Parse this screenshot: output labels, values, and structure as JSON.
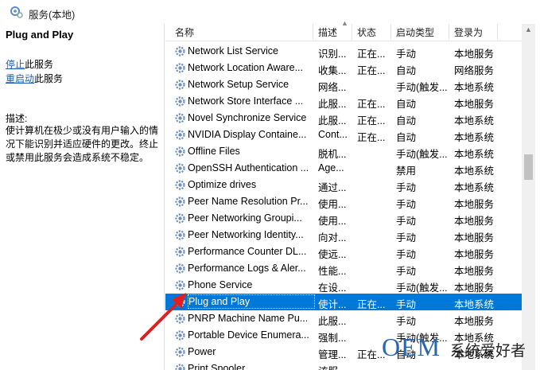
{
  "window": {
    "title": "服务(本地)"
  },
  "left_panel": {
    "service_name": "Plug and Play",
    "stop_link": "停止",
    "stop_suffix": "此服务",
    "restart_link": "重启动",
    "restart_suffix": "此服务",
    "desc_label": "描述:",
    "desc_text": "使计算机在极少或没有用户输入的情况下能识别并适应硬件的更改。终止或禁用此服务会造成系统不稳定。"
  },
  "table": {
    "headers": {
      "name": "名称",
      "desc": "描述",
      "status": "状态",
      "startup": "启动类型",
      "logon": "登录为"
    },
    "rows": [
      {
        "name": "Network List Service",
        "desc": "识别...",
        "status": "正在...",
        "startup": "手动",
        "logon": "本地服务"
      },
      {
        "name": "Network Location Aware...",
        "desc": "收集...",
        "status": "正在...",
        "startup": "自动",
        "logon": "网络服务"
      },
      {
        "name": "Network Setup Service",
        "desc": "网络...",
        "status": "",
        "startup": "手动(触发...",
        "logon": "本地系统"
      },
      {
        "name": "Network Store Interface ...",
        "desc": "此服...",
        "status": "正在...",
        "startup": "自动",
        "logon": "本地服务"
      },
      {
        "name": "Novel Synchronize Service",
        "desc": "此服...",
        "status": "正在...",
        "startup": "自动",
        "logon": "本地系统"
      },
      {
        "name": "NVIDIA Display Containe...",
        "desc": "Cont...",
        "status": "正在...",
        "startup": "自动",
        "logon": "本地系统"
      },
      {
        "name": "Offline Files",
        "desc": "脱机...",
        "status": "",
        "startup": "手动(触发...",
        "logon": "本地系统"
      },
      {
        "name": "OpenSSH Authentication ...",
        "desc": "Age...",
        "status": "",
        "startup": "禁用",
        "logon": "本地系统"
      },
      {
        "name": "Optimize drives",
        "desc": "通过...",
        "status": "",
        "startup": "手动",
        "logon": "本地系统"
      },
      {
        "name": "Peer Name Resolution Pr...",
        "desc": "使用...",
        "status": "",
        "startup": "手动",
        "logon": "本地服务"
      },
      {
        "name": "Peer Networking Groupi...",
        "desc": "使用...",
        "status": "",
        "startup": "手动",
        "logon": "本地服务"
      },
      {
        "name": "Peer Networking Identity...",
        "desc": "向对...",
        "status": "",
        "startup": "手动",
        "logon": "本地服务"
      },
      {
        "name": "Performance Counter DL...",
        "desc": "使远...",
        "status": "",
        "startup": "手动",
        "logon": "本地服务"
      },
      {
        "name": "Performance Logs & Aler...",
        "desc": "性能...",
        "status": "",
        "startup": "手动",
        "logon": "本地服务"
      },
      {
        "name": "Phone Service",
        "desc": "在设...",
        "status": "",
        "startup": "手动(触发...",
        "logon": "本地服务"
      },
      {
        "name": "Plug and Play",
        "desc": "使计...",
        "status": "正在...",
        "startup": "手动",
        "logon": "本地系统",
        "selected": true
      },
      {
        "name": "PNRP Machine Name Pu...",
        "desc": "此服...",
        "status": "",
        "startup": "手动",
        "logon": "本地服务"
      },
      {
        "name": "Portable Device Enumera...",
        "desc": "强制...",
        "status": "",
        "startup": "手动(触发...",
        "logon": "本地系统"
      },
      {
        "name": "Power",
        "desc": "管理...",
        "status": "正在...",
        "startup": "自动",
        "logon": "本地系统"
      },
      {
        "name": "Print Spooler",
        "desc": "该服...",
        "status": "",
        "startup": "",
        "logon": ""
      }
    ]
  },
  "watermark": {
    "brand": "OEM",
    "suffix": "系统爱好者"
  },
  "colors": {
    "selection": "#0078d7",
    "link": "#1a5fb4",
    "arrow": "#e02020"
  }
}
